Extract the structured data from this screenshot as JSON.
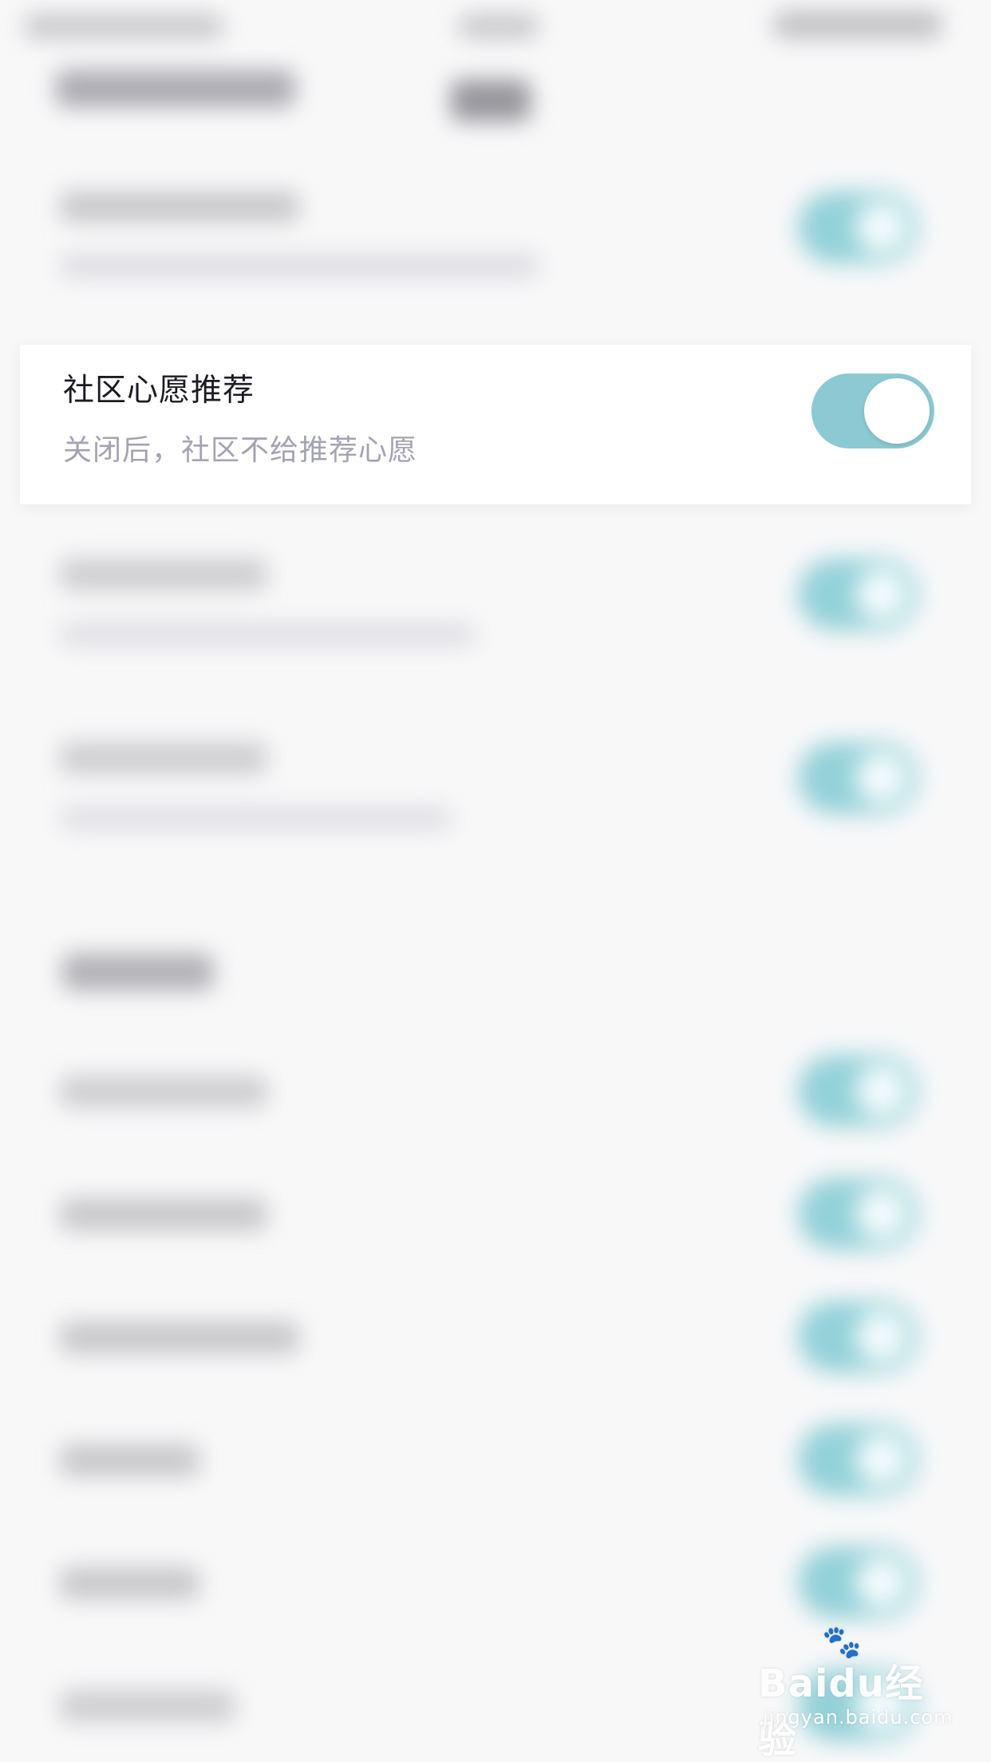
{
  "settings": {
    "focused_item": {
      "title": "社区心愿推荐",
      "subtitle": "关闭后，社区不给推荐心愿",
      "enabled": true
    }
  },
  "colors": {
    "toggle_on": "#8cc9d2",
    "title": "#1b1b24",
    "subtitle": "#a3a3b3",
    "background": "#f8f8f9"
  },
  "watermark": {
    "logo": "Baidu经验",
    "url": "jingyan.baidu.com"
  }
}
